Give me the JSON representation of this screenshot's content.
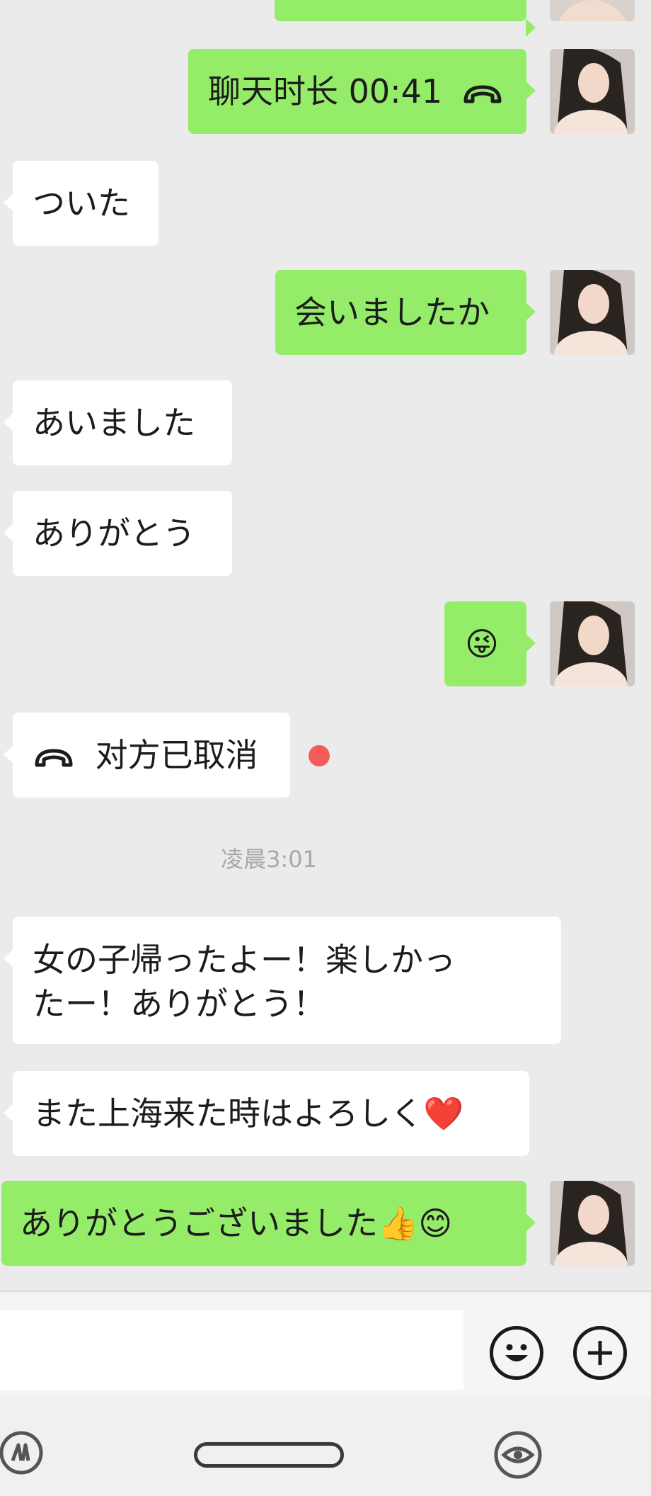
{
  "messages": {
    "call_duration": "聊天时长 00:41",
    "m1": "ついた",
    "m2": "会いましたか",
    "m3": "あいました",
    "m4": "ありがとう",
    "m5_emoji": "😜",
    "call_cancelled": "对方已取消",
    "timestamp": "凌晨3:01",
    "m6_line1": "女の子帰ったよー！楽しかっ",
    "m6_line2": "たー！ありがとう！",
    "m7": "また上海来た時はよろしく",
    "m7_emoji": "❤️",
    "m8": "ありがとうございました",
    "m8_emoji": "👍😊"
  },
  "colors": {
    "outgoing_bubble": "#95ec69",
    "incoming_bubble": "#ffffff",
    "background": "#ebebeb",
    "unread_dot": "#f25c5c"
  },
  "icons": {
    "call": "phone-hangup-icon",
    "emoji": "smiley-icon",
    "more": "plus-circle-icon",
    "nav_left": "app-switch-icon",
    "nav_right": "eye-icon"
  }
}
